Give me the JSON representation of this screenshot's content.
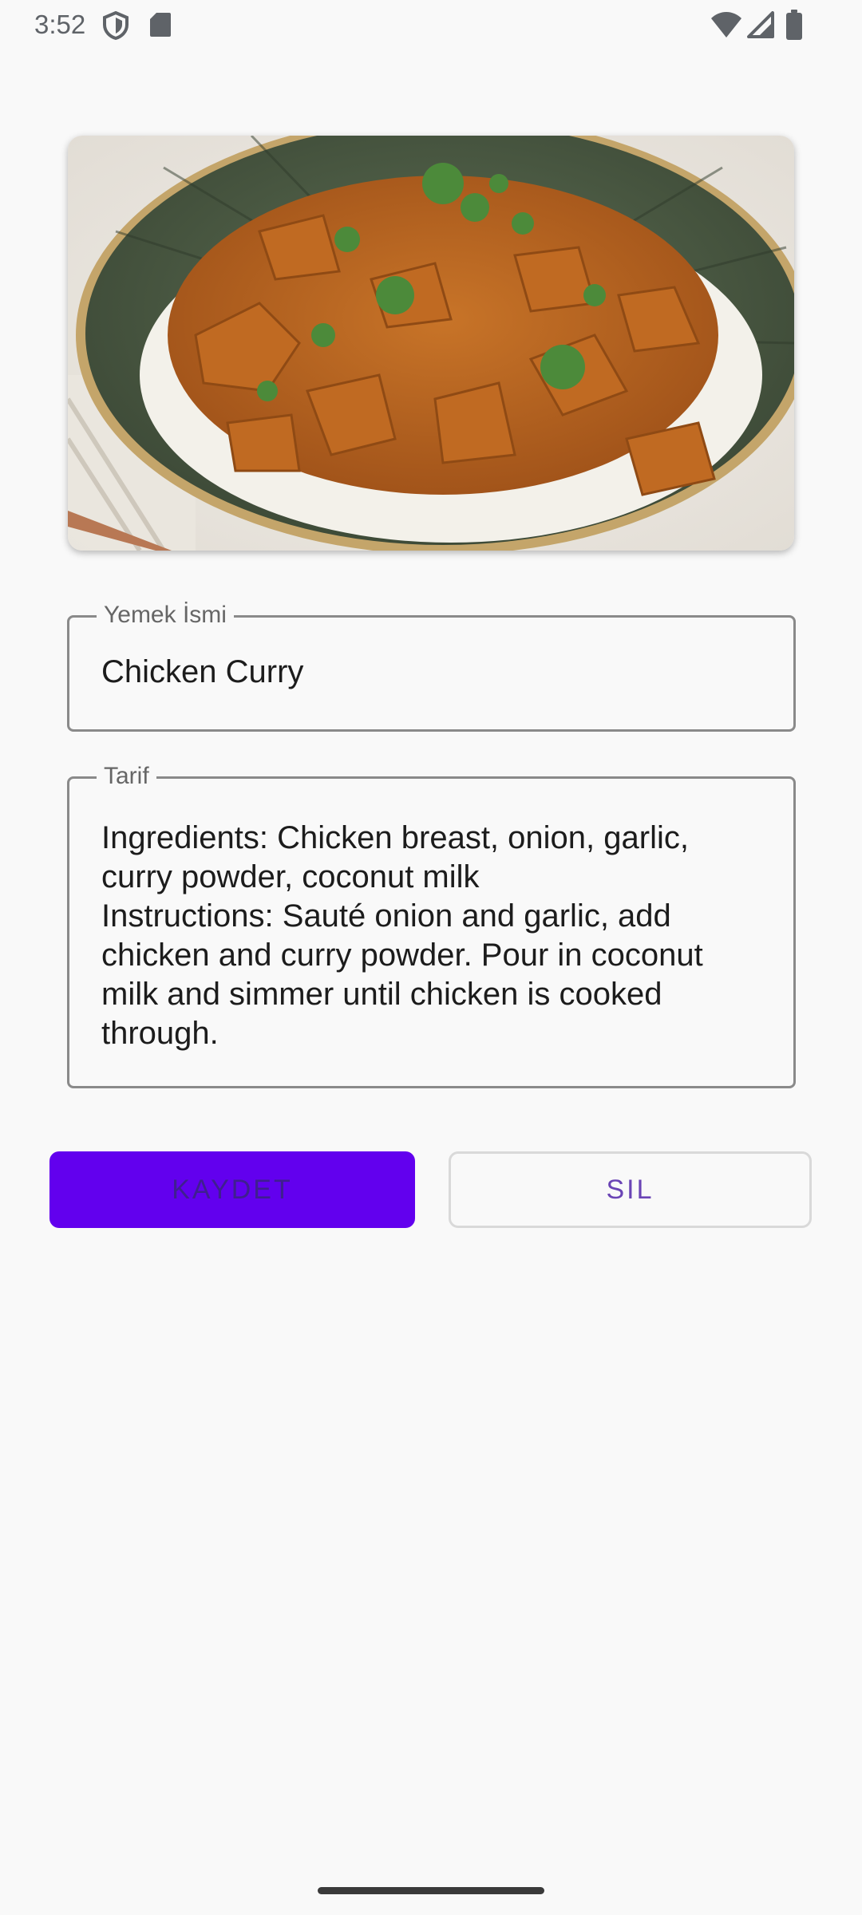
{
  "status_bar": {
    "time": "3:52",
    "left_icons": [
      "shield-icon",
      "sd-card-icon"
    ],
    "right_icons": [
      "wifi-icon",
      "cellular-signal-icon",
      "battery-icon"
    ]
  },
  "food_image": {
    "subject": "chicken-curry-photo"
  },
  "form": {
    "name_field": {
      "label": "Yemek İsmi",
      "value": "Chicken Curry"
    },
    "recipe_field": {
      "label": "Tarif",
      "value": "Ingredients: Chicken breast, onion, garlic,\ncurry powder, coconut milk\nInstructions: Sauté onion and garlic, add\nchicken and curry powder. Pour in coconut\nmilk and simmer until chicken is cooked\nthrough."
    }
  },
  "actions": {
    "save_label": "KAYDET",
    "delete_label": "SIL"
  },
  "colors": {
    "primary": "#6200ee",
    "delete_text": "#6a44b5"
  }
}
